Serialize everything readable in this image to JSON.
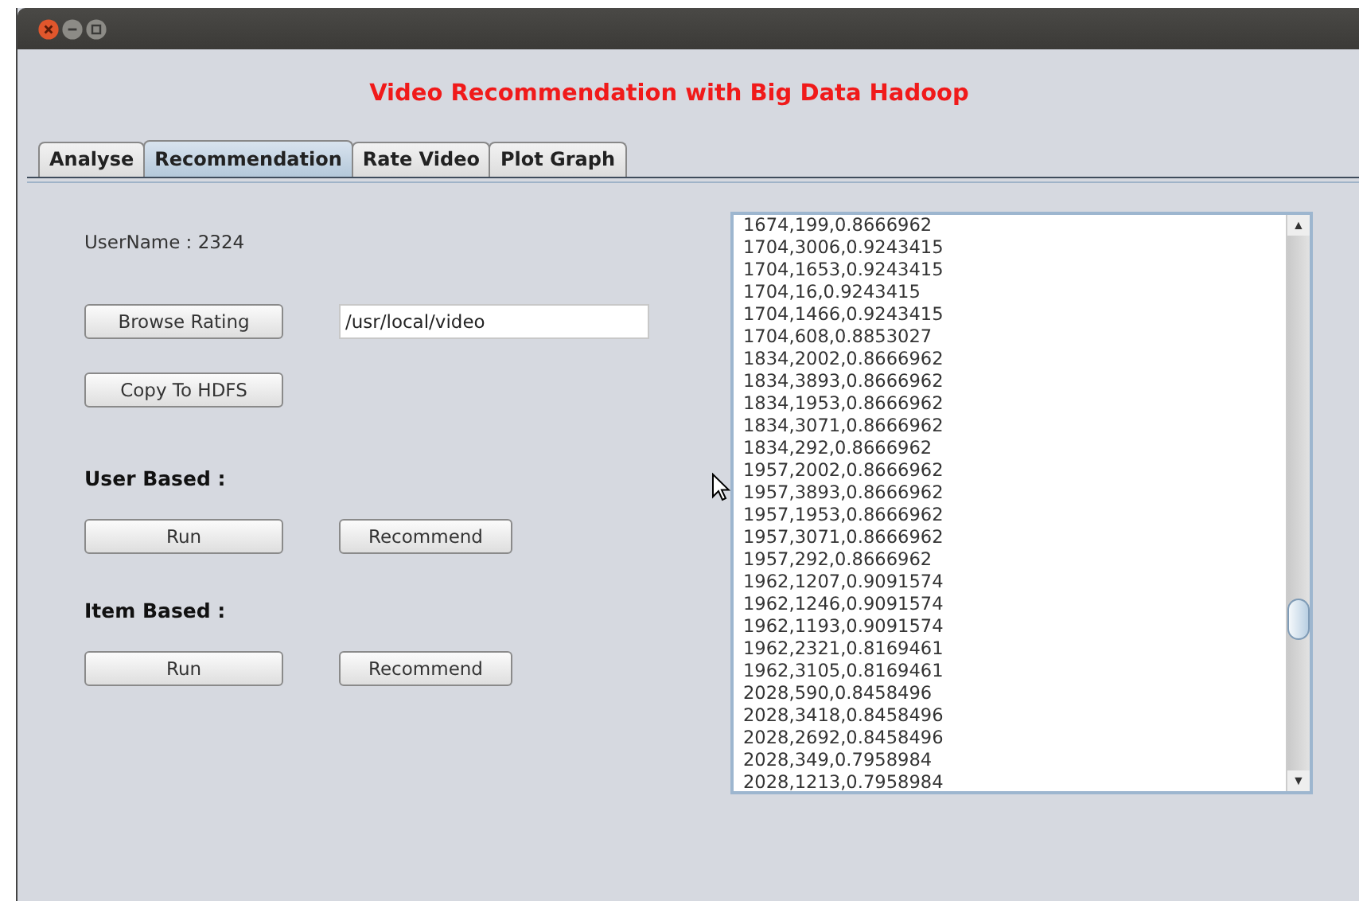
{
  "window": {
    "title": "Video Recommendation with Big Data Hadoop"
  },
  "tabs": [
    {
      "label": "Analyse",
      "selected": false
    },
    {
      "label": "Recommendation",
      "selected": true
    },
    {
      "label": "Rate Video",
      "selected": false
    },
    {
      "label": "Plot Graph",
      "selected": false
    }
  ],
  "username": "UserName : 2324",
  "browse_button": "Browse Rating",
  "path_field": {
    "value": "/usr/local/video"
  },
  "copy_button": "Copy To HDFS",
  "user_based": {
    "heading": "User Based :",
    "run": "Run",
    "recommend": "Recommend"
  },
  "item_based": {
    "heading": "Item Based :",
    "run": "Run",
    "recommend": "Recommend"
  },
  "results": [
    "1674,199,0.8666962",
    "1704,3006,0.9243415",
    "1704,1653,0.9243415",
    "1704,16,0.9243415",
    "1704,1466,0.9243415",
    "1704,608,0.8853027",
    "1834,2002,0.8666962",
    "1834,3893,0.8666962",
    "1834,1953,0.8666962",
    "1834,3071,0.8666962",
    "1834,292,0.8666962",
    "1957,2002,0.8666962",
    "1957,3893,0.8666962",
    "1957,1953,0.8666962",
    "1957,3071,0.8666962",
    "1957,292,0.8666962",
    "1962,1207,0.9091574",
    "1962,1246,0.9091574",
    "1962,1193,0.9091574",
    "1962,2321,0.8169461",
    "1962,3105,0.8169461",
    "2028,590,0.8458496",
    "2028,3418,0.8458496",
    "2028,2692,0.8458496",
    "2028,349,0.7958984",
    "2028,1213,0.7958984"
  ],
  "scroll_arrows": {
    "up": "▲",
    "down": "▼"
  }
}
